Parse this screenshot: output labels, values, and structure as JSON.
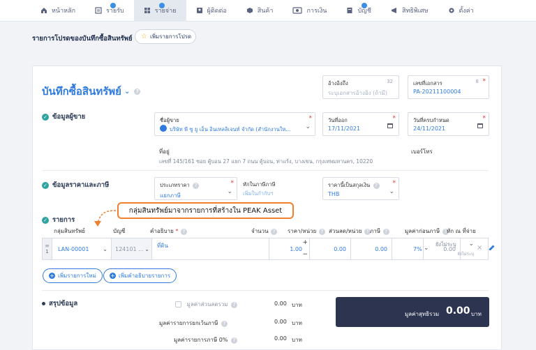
{
  "nav": {
    "items": [
      {
        "label": "หน้าหลัก",
        "icon": "home-icon"
      },
      {
        "label": "รายรับ",
        "icon": "income-icon"
      },
      {
        "label": "รายจ่าย",
        "icon": "expense-icon"
      },
      {
        "label": "ผู้ติดต่อ",
        "icon": "contacts-icon"
      },
      {
        "label": "สินค้า",
        "icon": "box-icon"
      },
      {
        "label": "การเงิน",
        "icon": "money-icon"
      },
      {
        "label": "บัญชี",
        "icon": "ledger-icon"
      },
      {
        "label": "สิทธิพิเศษ",
        "icon": "privilege-icon"
      },
      {
        "label": "ตั้งค่า",
        "icon": "gear-icon"
      }
    ]
  },
  "section": {
    "title": "รายการโปรดของบันทึกซื้อสินทรัพย์",
    "fav_button": "เพิ่มรายการโปรด"
  },
  "doc": {
    "title": "บันทึกซื้อสินทรัพย์",
    "reference": {
      "label": "อ้างอิงถึง",
      "placeholder": "ระบุเอกสารอ้างอิง (ถ้ามี)",
      "counter": "32"
    },
    "doc_number": {
      "label": "เลขที่เอกสาร",
      "value": "PA-20211100004",
      "counter": "8"
    }
  },
  "vendor": {
    "section_label": "ข้อมูลผู้ขาย",
    "vendor_field": {
      "label": "ชื่อผู้ขาย",
      "value": "บริษัท พี ซู ยู เอ็น อินเทลลิเจนท์ จำกัด (สำนักงานให..."
    },
    "issue_date": {
      "label": "วันที่ออก",
      "value": "17/11/2021"
    },
    "due_date": {
      "label": "วันที่ครบกำหนด",
      "value": "24/11/2021"
    },
    "address_label": "ที่อยู่",
    "address_value": "เลขที่ 145/161 ซอย คู้บอน 27 แยก 7 ถนน คู้บอน, ท่าแร้ง, บางเขน, กรุงเทพมหานคร, 10220",
    "tax_id_label": "เบอร์โทร"
  },
  "pricing": {
    "section_label": "ข้อมูลราคาและภาษี",
    "price_type": {
      "label": "ประเภทราคา",
      "value": "แยกภาษี"
    },
    "withholding": {
      "label": "หักในภาษีภาษี",
      "placeholder": "เพิ่มในกำกับฯ"
    },
    "currency": {
      "label": "ราคานี้เป็นสกุลเงิน",
      "value": "THB"
    }
  },
  "callout": "กลุ่มสินทรัพย์มาจากรายการที่สร้างใน PEAK Asset",
  "items": {
    "section_label": "รายการ",
    "headers": {
      "group": "กลุ่มสินทรัพย์",
      "account": "บัญชี",
      "description": "คำอธิบาย",
      "qty": "จำนวน",
      "unit_price": "ราคา/หน่วย",
      "discount": "ส่วนลด/หน่วย",
      "vat": "ภาษี",
      "pre_tax": "มูลค่าก่อนภาษี",
      "withholding": "หัก ณ ที่จ่าย"
    },
    "row": {
      "index": "1",
      "group": "LAN-00001",
      "account": "124101 ...",
      "description": "ที่ดิน",
      "qty": "1.00",
      "unit_price": "0.00",
      "discount": "0.00",
      "vat": "7%",
      "pre_tax": "0.00",
      "withholding": "ยังไม่ระบุ",
      "withholding_sub": "ยังไม่ระบุ"
    },
    "add_row_button": "เพิ่มรายการใหม่",
    "add_desc_button": "เพิ่มคำอธิบายรายการ"
  },
  "summary": {
    "title": "สรุปข้อมูล",
    "discount_total": {
      "label": "มูลค่าส่วนลดรวม",
      "value": "0.00",
      "unit": "บาท"
    },
    "exempt": {
      "label": "มูลค่ารายการยกเว้นภาษี",
      "value": "0.00",
      "unit": "บาท"
    },
    "zero_vat": {
      "label": "มูลค่ารายการภาษี 0%",
      "value": "0.00",
      "unit": "บาท"
    },
    "grand_total": {
      "label": "มูลค่าสุทธิรวม",
      "value": "0.00",
      "unit": "บาท"
    }
  }
}
